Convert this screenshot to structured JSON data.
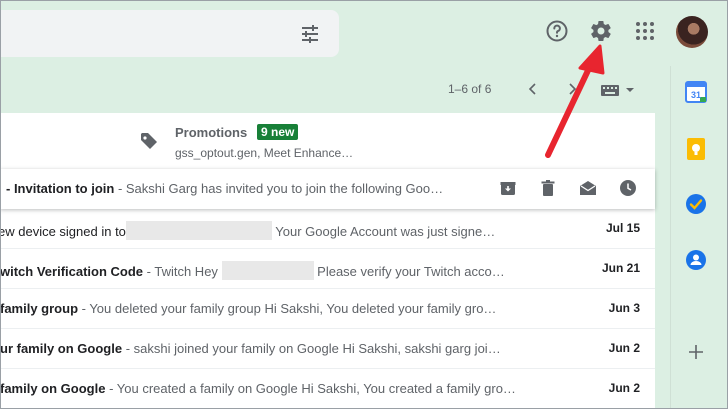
{
  "icons": {
    "tune": "tune-icon",
    "help": "help-icon",
    "settings": "gear-icon",
    "apps": "apps-grid-icon",
    "label": "tag-icon",
    "archive": "archive-icon",
    "delete": "trash-icon",
    "mark_read": "mark-read-icon",
    "snooze": "clock-icon",
    "calendar": "calendar-icon",
    "keep": "keep-icon",
    "tasks": "tasks-icon",
    "contacts": "contacts-icon",
    "add": "plus-icon"
  },
  "pagination": {
    "range": "1–6 of 6"
  },
  "promotions": {
    "title": "Promotions",
    "badge": "9 new",
    "senders": "gss_optout.gen, Meet Enhance…"
  },
  "calendar_day": "31",
  "emails": [
    {
      "subject": "- Invitation to join",
      "snippet": " - Sakshi Garg has invited you to join the following Goo…",
      "date": "",
      "hovered": true
    },
    {
      "subject": "",
      "prefix": "ew device signed in to",
      "snippet": " Your Google Account was just signe…",
      "date": "Jul 15"
    },
    {
      "subject": "witch Verification Code",
      "snippet": " - Twitch Hey ",
      "snippet2": " Please verify your Twitch acco…",
      "date": "Jun 21"
    },
    {
      "subject": "family group",
      "snippet": " - You deleted your family group Hi Sakshi, You deleted your family gro…",
      "date": "Jun 3"
    },
    {
      "subject": "ur family on Google",
      "snippet": " - sakshi joined your family on Google Hi Sakshi, sakshi garg joi…",
      "date": "Jun 2"
    },
    {
      "subject": "family on Google",
      "snippet": " - You created a family on Google Hi Sakshi, You created a family gro…",
      "date": "Jun 2"
    }
  ],
  "colors": {
    "background": "#dcefe3",
    "badge": "#188038",
    "annotation_arrow": "#e8252f"
  }
}
